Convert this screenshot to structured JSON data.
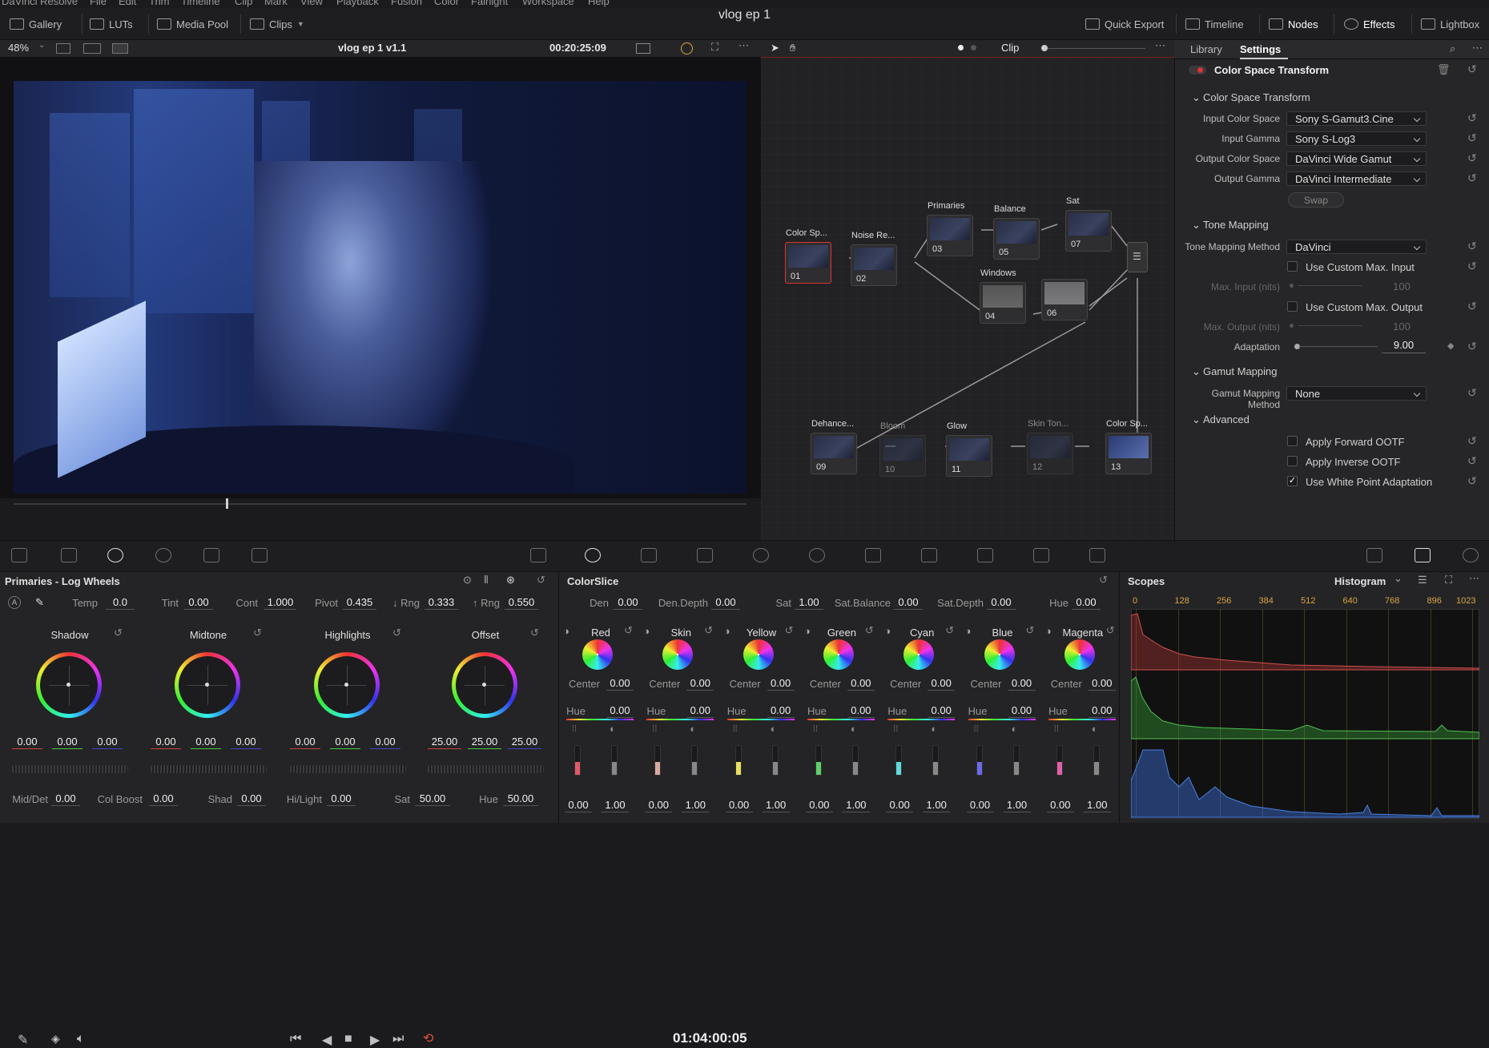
{
  "menu": {
    "items": [
      "DaVinci Resolve",
      "File",
      "Edit",
      "Trim",
      "Timeline",
      "Clip",
      "Mark",
      "View",
      "Playback",
      "Fusion",
      "Color",
      "Fairlight",
      "Workspace",
      "Help"
    ]
  },
  "topbar": {
    "gallery": "Gallery",
    "luts": "LUTs",
    "media_pool": "Media Pool",
    "clips": "Clips",
    "title": "vlog ep 1",
    "quick_export": "Quick Export",
    "timeline": "Timeline",
    "nodes": "Nodes",
    "effects": "Effects",
    "lightbox": "Lightbox"
  },
  "viewer": {
    "zoom": "48%",
    "clip_name": "vlog ep 1 v1.1",
    "timecode_top": "00:20:25:09",
    "timecode": "01:04:00:05",
    "playhead_fraction": 0.29
  },
  "nodes": {
    "mode": "Clip",
    "items": [
      {
        "label": "Color Sp...",
        "num": "01"
      },
      {
        "label": "Noise Re...",
        "num": "02"
      },
      {
        "label": "Primaries",
        "num": "03"
      },
      {
        "label": "Windows",
        "num": "04"
      },
      {
        "label": "Balance",
        "num": "05"
      },
      {
        "label": "",
        "num": "06"
      },
      {
        "label": "Sat",
        "num": "07"
      },
      {
        "label": "Dehance...",
        "num": "09"
      },
      {
        "label": "Bloom",
        "num": "10"
      },
      {
        "label": "Glow",
        "num": "11"
      },
      {
        "label": "Skin Ton...",
        "num": "12"
      },
      {
        "label": "Color Sp...",
        "num": "13"
      }
    ]
  },
  "right": {
    "tab_library": "Library",
    "tab_settings": "Settings",
    "effect_title": "Color Space Transform",
    "section_cst": "Color Space Transform",
    "input_cs_label": "Input Color Space",
    "input_cs": "Sony S-Gamut3.Cine",
    "input_gamma_label": "Input Gamma",
    "input_gamma": "Sony S-Log3",
    "output_cs_label": "Output Color Space",
    "output_cs": "DaVinci Wide Gamut",
    "output_gamma_label": "Output Gamma",
    "output_gamma": "DaVinci Intermediate",
    "swap": "Swap",
    "section_tone": "Tone Mapping",
    "tone_method_label": "Tone Mapping Method",
    "tone_method": "DaVinci",
    "custom_max_input": "Use Custom Max. Input",
    "max_input_label": "Max. Input (nits)",
    "max_input": "100",
    "custom_max_output": "Use Custom Max. Output",
    "max_output_label": "Max. Output (nits)",
    "max_output": "100",
    "adaptation_label": "Adaptation",
    "adaptation": "9.00",
    "section_gamut": "Gamut Mapping",
    "gamut_method_label": "Gamut Mapping Method",
    "gamut_method": "None",
    "section_adv": "Advanced",
    "fwd_ootf": "Apply Forward OOTF",
    "inv_ootf": "Apply Inverse OOTF",
    "white_point": "Use White Point Adaptation"
  },
  "primaries": {
    "title": "Primaries - Log Wheels",
    "temp_l": "Temp",
    "temp": "0.0",
    "tint_l": "Tint",
    "tint": "0.00",
    "cont_l": "Cont",
    "cont": "1.000",
    "pivot_l": "Pivot",
    "pivot": "0.435",
    "lrng_l": "↓ Rng",
    "lrng": "0.333",
    "hrng_l": "↑ Rng",
    "hrng": "0.550",
    "wheels": [
      {
        "name": "Shadow",
        "v": [
          "0.00",
          "0.00",
          "0.00"
        ]
      },
      {
        "name": "Midtone",
        "v": [
          "0.00",
          "0.00",
          "0.00"
        ]
      },
      {
        "name": "Highlights",
        "v": [
          "0.00",
          "0.00",
          "0.00"
        ]
      },
      {
        "name": "Offset",
        "v": [
          "25.00",
          "25.00",
          "25.00"
        ]
      }
    ],
    "middet_l": "Mid/Det",
    "middet": "0.00",
    "colboost_l": "Col Boost",
    "colboost": "0.00",
    "shad_l": "Shad",
    "shad": "0.00",
    "hilight_l": "Hi/Light",
    "hilight": "0.00",
    "sat_l": "Sat",
    "sat": "50.00",
    "hue_l": "Hue",
    "hue": "50.00"
  },
  "colorslice": {
    "title": "ColorSlice",
    "den_l": "Den",
    "den": "0.00",
    "dendepth_l": "Den.Depth",
    "dendepth": "0.00",
    "sat_l": "Sat",
    "sat": "1.00",
    "satbal_l": "Sat.Balance",
    "satbal": "0.00",
    "satdepth_l": "Sat.Depth",
    "satdepth": "0.00",
    "hue_l": "Hue",
    "hue": "0.00",
    "center_l": "Center",
    "hue_row_l": "Hue",
    "slices": [
      {
        "name": "Red",
        "center": "0.00",
        "hue": "0.00",
        "a": "0.00",
        "b": "1.00",
        "color": "#e05a6a"
      },
      {
        "name": "Skin",
        "center": "0.00",
        "hue": "0.00",
        "a": "0.00",
        "b": "1.00",
        "color": "#d9a9a0"
      },
      {
        "name": "Yellow",
        "center": "0.00",
        "hue": "0.00",
        "a": "0.00",
        "b": "1.00",
        "color": "#e8e060"
      },
      {
        "name": "Green",
        "center": "0.00",
        "hue": "0.00",
        "a": "0.00",
        "b": "1.00",
        "color": "#5ed06a"
      },
      {
        "name": "Cyan",
        "center": "0.00",
        "hue": "0.00",
        "a": "0.00",
        "b": "1.00",
        "color": "#60d8e0"
      },
      {
        "name": "Blue",
        "center": "0.00",
        "hue": "0.00",
        "a": "0.00",
        "b": "1.00",
        "color": "#6a6ae8"
      },
      {
        "name": "Magenta",
        "center": "0.00",
        "hue": "0.00",
        "a": "0.00",
        "b": "1.00",
        "color": "#e060a8"
      }
    ]
  },
  "scopes": {
    "title": "Scopes",
    "mode": "Histogram",
    "ticks": [
      "0",
      "128",
      "256",
      "384",
      "512",
      "640",
      "768",
      "896",
      "1023"
    ]
  }
}
